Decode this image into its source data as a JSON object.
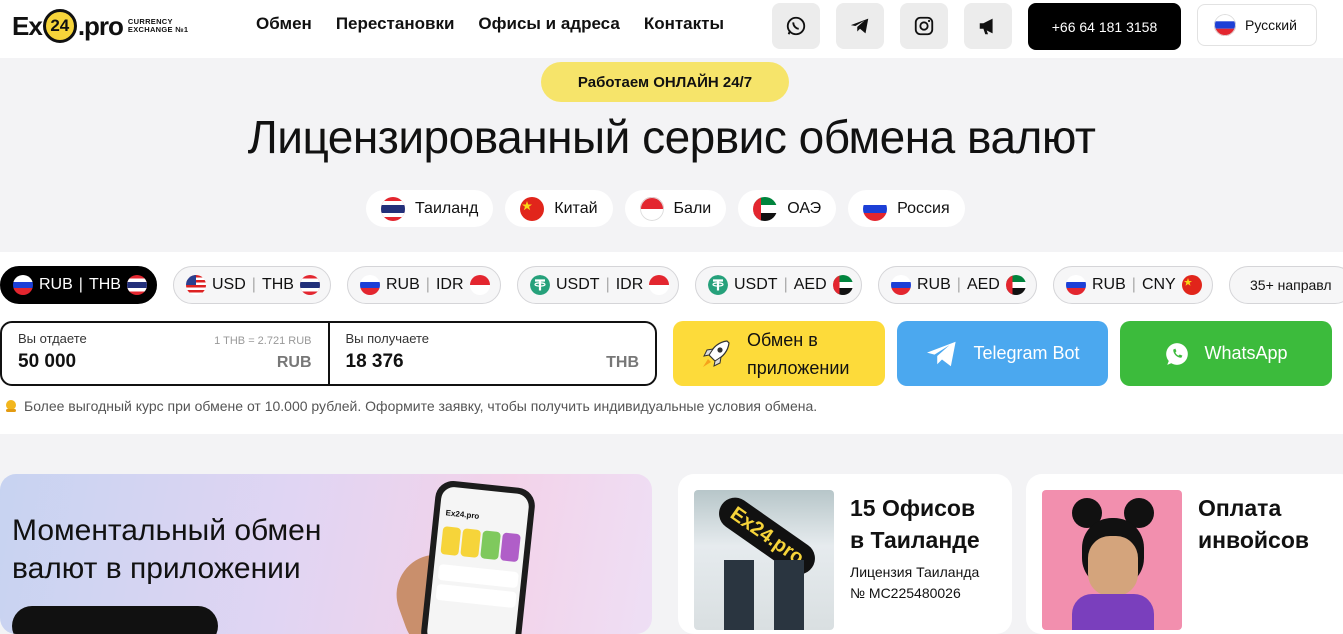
{
  "logo": {
    "text1": "Ex",
    "text2": "24",
    "text3": ".pro",
    "tag1": "CURRENCY",
    "tag2": "EXCHANGE №1"
  },
  "nav": [
    "Обмен",
    "Перестановки",
    "Офисы и адреса",
    "Контакты"
  ],
  "social_icons": [
    "whatsapp-icon",
    "telegram-icon",
    "instagram-icon",
    "megaphone-icon"
  ],
  "phone": "+66 64 181 3158",
  "language": "Русский",
  "badge": "Работаем ОНЛАЙН 24/7",
  "hero_title": "Лицензированный сервис обмена валют",
  "countries": [
    "Таиланд",
    "Китай",
    "Бали",
    "ОАЭ",
    "Россия"
  ],
  "pairs": [
    {
      "a": "RUB",
      "b": "THB"
    },
    {
      "a": "USD",
      "b": "THB"
    },
    {
      "a": "RUB",
      "b": "IDR"
    },
    {
      "a": "USDT",
      "b": "IDR"
    },
    {
      "a": "USDT",
      "b": "AED"
    },
    {
      "a": "RUB",
      "b": "AED"
    },
    {
      "a": "RUB",
      "b": "CNY"
    }
  ],
  "more_directions": "35+ направл",
  "calc": {
    "give_label": "Вы отдаете",
    "give_value": "50 000",
    "give_cur": "RUB",
    "rate": "1 THB = 2.721 RUB",
    "get_label": "Вы получаете",
    "get_value": "18 376",
    "get_cur": "THB"
  },
  "buttons": {
    "app_line1": "Обмен в",
    "app_line2": "приложении",
    "telegram": "Telegram Bot",
    "whatsapp": "WhatsApp"
  },
  "note": "Более выгодный курс при обмене от 10.000 рублей. Оформите заявку, чтобы получить индивидуальные условия обмена.",
  "cards": {
    "app_line1": "Моментальный обмен",
    "app_line2": "валют в приложении",
    "offices_line1": "15 Офисов",
    "offices_line2": "в Таиланде",
    "license_line1": "Лицензия Таиланда",
    "license_line2": "№ MC225480026",
    "invoice_line1": "Оплата",
    "invoice_line2": "инвойсов"
  },
  "colors": {
    "accent_yellow": "#f6d43a",
    "telegram_blue": "#4ba8ef",
    "whatsapp_green": "#3cbb3c",
    "app_yellow": "#fddb3a"
  }
}
